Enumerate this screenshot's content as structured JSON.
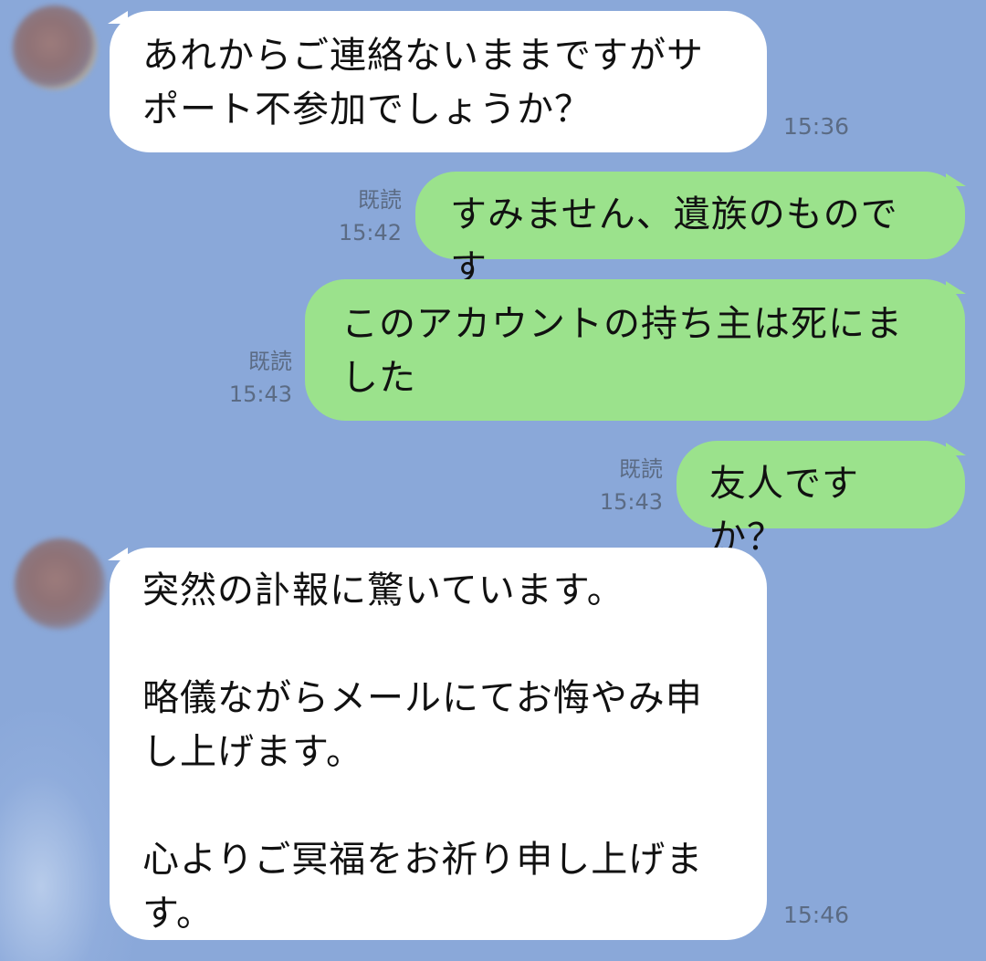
{
  "messages": [
    {
      "id": "m1",
      "side": "incoming",
      "text": "あれからご連絡ないままですがサ\nポート不参加でしょうか？",
      "time": "15:36"
    },
    {
      "id": "m2",
      "side": "outgoing",
      "read": "既読",
      "text": "すみません、遺族のものです",
      "time": "15:42"
    },
    {
      "id": "m3",
      "side": "outgoing",
      "read": "既読",
      "text": "このアカウントの持ち主は死にま\nした",
      "time": "15:43"
    },
    {
      "id": "m4",
      "side": "outgoing",
      "read": "既読",
      "text": "友人ですか？",
      "time": "15:43"
    },
    {
      "id": "m5",
      "side": "incoming",
      "text": "突然の訃報に驚いています。\n\n略儀ながらメールにてお悔やみ申\nし上げます。\n\n心よりご冥福をお祈り申し上げま\nす。",
      "time": "15:46"
    }
  ],
  "colors": {
    "background": "#8aa8d9",
    "incoming_bubble": "#ffffff",
    "outgoing_bubble": "#9be28c",
    "meta_text": "#5b6b84"
  }
}
